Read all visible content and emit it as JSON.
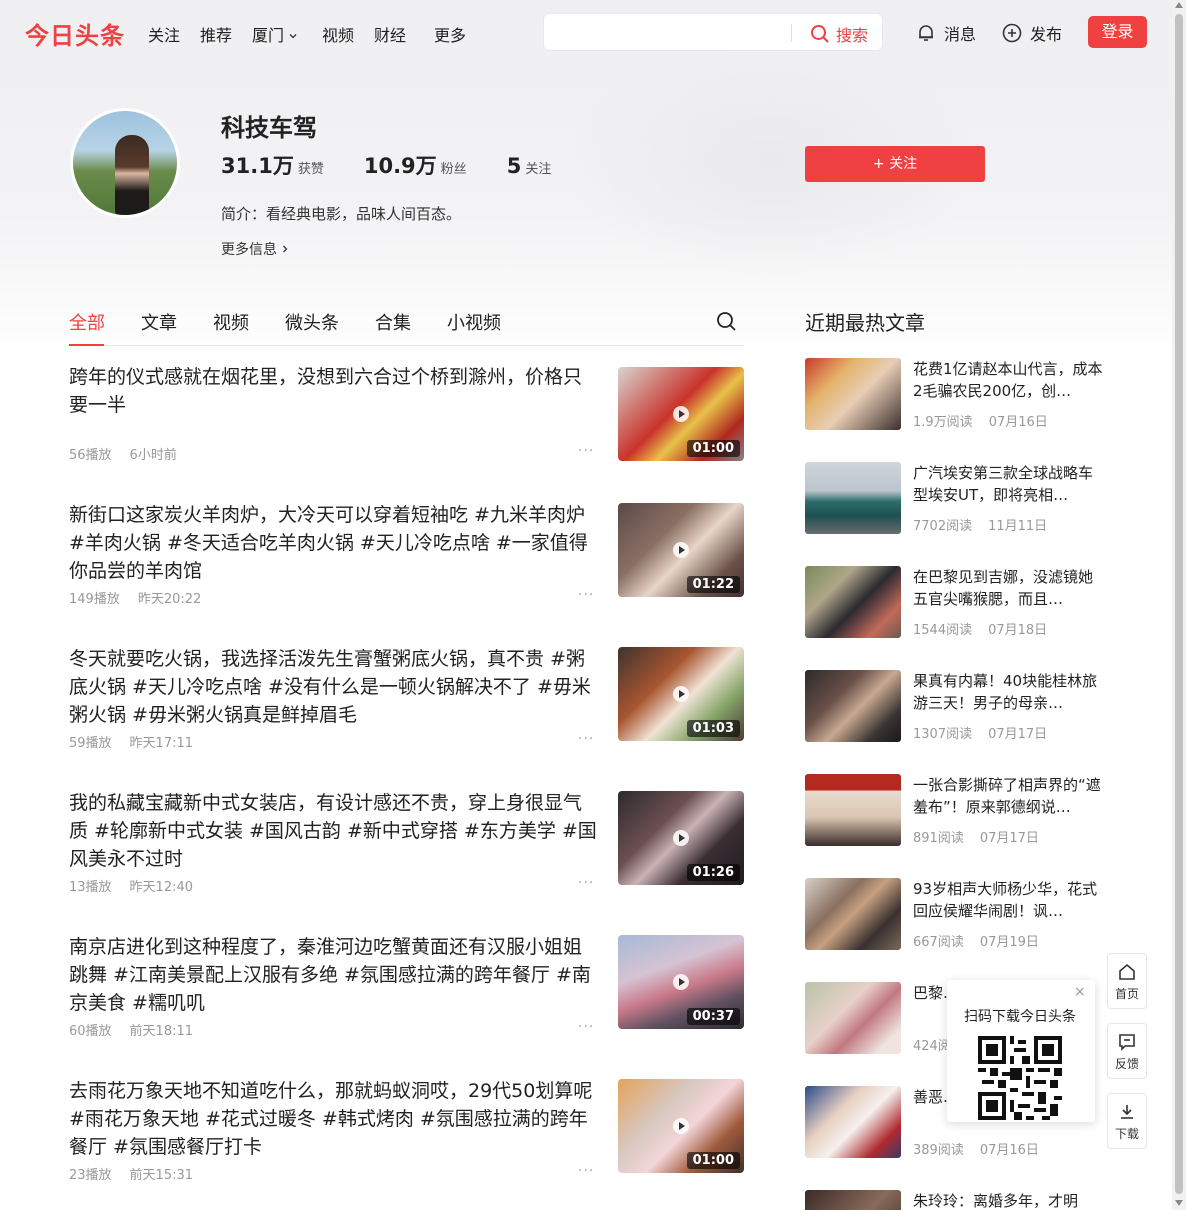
{
  "header": {
    "logo": "今日头条",
    "nav": [
      "关注",
      "推荐",
      "厦门",
      "视频",
      "财经",
      "更多"
    ],
    "search_button": "搜索",
    "search_placeholder": "",
    "messages": "消息",
    "publish": "发布",
    "login": "登录"
  },
  "profile": {
    "name": "科技车驾",
    "stats": [
      {
        "value": "31.1万",
        "label": "获赞"
      },
      {
        "value": "10.9万",
        "label": "粉丝"
      },
      {
        "value": "5",
        "label": "关注"
      }
    ],
    "intro": "简介：看经典电影，品味人间百态。",
    "more_info": "更多信息",
    "follow_button": "+ 关注"
  },
  "tabs": [
    "全部",
    "文章",
    "视频",
    "微头条",
    "合集",
    "小视频"
  ],
  "active_tab": "全部",
  "feed": [
    {
      "title": "跨年的仪式感就在烟花里，没想到六合过个桥到滁州，价格只要一半",
      "plays": "56播放",
      "time": "6小时前",
      "duration": "01:00"
    },
    {
      "title": "新街口这家炭火羊肉炉，大冷天可以穿着短袖吃 #九米羊肉炉 #羊肉火锅 #冬天适合吃羊肉火锅 #天儿冷吃点啥 #一家值得你品尝的羊肉馆",
      "plays": "149播放",
      "time": "昨天20:22",
      "duration": "01:22"
    },
    {
      "title": "冬天就要吃火锅，我选择活泼先生膏蟹粥底火锅，真不贵 #粥底火锅 #天儿冷吃点啥 #没有什么是一顿火锅解决不了 #毋米粥火锅 #毋米粥火锅真是鲜掉眉毛",
      "plays": "59播放",
      "time": "昨天17:11",
      "duration": "01:03"
    },
    {
      "title": "我的私藏宝藏新中式女装店，有设计感还不贵，穿上身很显气质 #轮廓新中式女装 #国风古韵 #新中式穿搭 #东方美学 #国风美永不过时",
      "plays": "13播放",
      "time": "昨天12:40",
      "duration": "01:26"
    },
    {
      "title": "南京店进化到这种程度了，秦淮河边吃蟹黄面还有汉服小姐姐跳舞 #江南美景配上汉服有多绝 #氛围感拉满的跨年餐厅 #南京美食 #糯叽叽",
      "plays": "60播放",
      "time": "前天18:11",
      "duration": "00:37"
    },
    {
      "title": "去雨花万象天地不知道吃什么，那就蚂蚁洞哎，29代50划算呢 #雨花万象天地 #花式过暖冬 #韩式烤肉 #氛围感拉满的跨年餐厅 #氛围感餐厅打卡",
      "plays": "23播放",
      "time": "前天15:31",
      "duration": "01:00"
    }
  ],
  "feed_more": "···",
  "sidebar": {
    "title": "近期最热文章",
    "items": [
      {
        "title": "花费1亿请赵本山代言，成本2毛骗农民200亿，创…",
        "reads": "1.9万阅读",
        "date": "07月16日"
      },
      {
        "title": "广汽埃安第三款全球战略车型埃安UT，即将亮相…",
        "reads": "7702阅读",
        "date": "11月11日"
      },
      {
        "title": "在巴黎见到吉娜，没滤镜她五官尖嘴猴腮，而且…",
        "reads": "1544阅读",
        "date": "07月18日"
      },
      {
        "title": "果真有内幕！40块能桂林旅游三天！男子的母亲…",
        "reads": "1307阅读",
        "date": "07月17日"
      },
      {
        "title": "一张合影撕碎了相声界的“遮羞布”！原来郭德纲说…",
        "reads": "891阅读",
        "date": "07月17日"
      },
      {
        "title": "93岁相声大师杨少华，花式回应侯耀华闹剧！讽…",
        "reads": "667阅读",
        "date": "07月19日"
      },
      {
        "title": "巴黎…谷爱…",
        "reads": "424阅读",
        "date": ""
      },
      {
        "title": "善恶…8年后…",
        "reads": "389阅读",
        "date": "07月16日"
      },
      {
        "title": "朱玲玲：离婚多年，才明",
        "reads": "",
        "date": ""
      }
    ]
  },
  "float": {
    "home": "首页",
    "feedback": "反馈",
    "download": "下载",
    "qr_title": "扫码下载今日头条",
    "qr_close": "×"
  }
}
